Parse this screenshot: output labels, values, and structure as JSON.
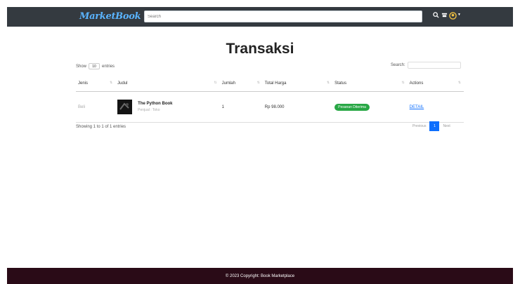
{
  "navbar": {
    "brand": "MarketBook",
    "search_placeholder": "Search",
    "icons": [
      "search-icon",
      "cart-icon",
      "user-icon",
      "chevron-down-icon"
    ]
  },
  "page": {
    "title": "Transaksi"
  },
  "table_controls": {
    "show_label": "Show",
    "entries_value": "10",
    "entries_label": "entries",
    "search_label": "Search:"
  },
  "table": {
    "columns": [
      "Jenis",
      "Judul",
      "Jumlah",
      "Total Harga",
      "Status",
      "Actions"
    ],
    "rows": [
      {
        "jenis": "Beli",
        "title": "The Python Book",
        "subtitle": "Penjual : Toko",
        "jumlah": "1",
        "total": "Rp 98.000",
        "status": "Pesanan Diterima",
        "action": "DETAIL"
      }
    ]
  },
  "info": "Showing 1 to 1 of 1 entries",
  "pagination": {
    "previous": "Previous",
    "page": "1",
    "next": "Next"
  },
  "footer": {
    "text": "© 2023 Copyright: Book Marketplace"
  },
  "colors": {
    "navbar": "#343a40",
    "footer": "#2a0b17",
    "accent": "#0d6efd",
    "status": "#28a745",
    "brand": "#5ab4ff"
  }
}
